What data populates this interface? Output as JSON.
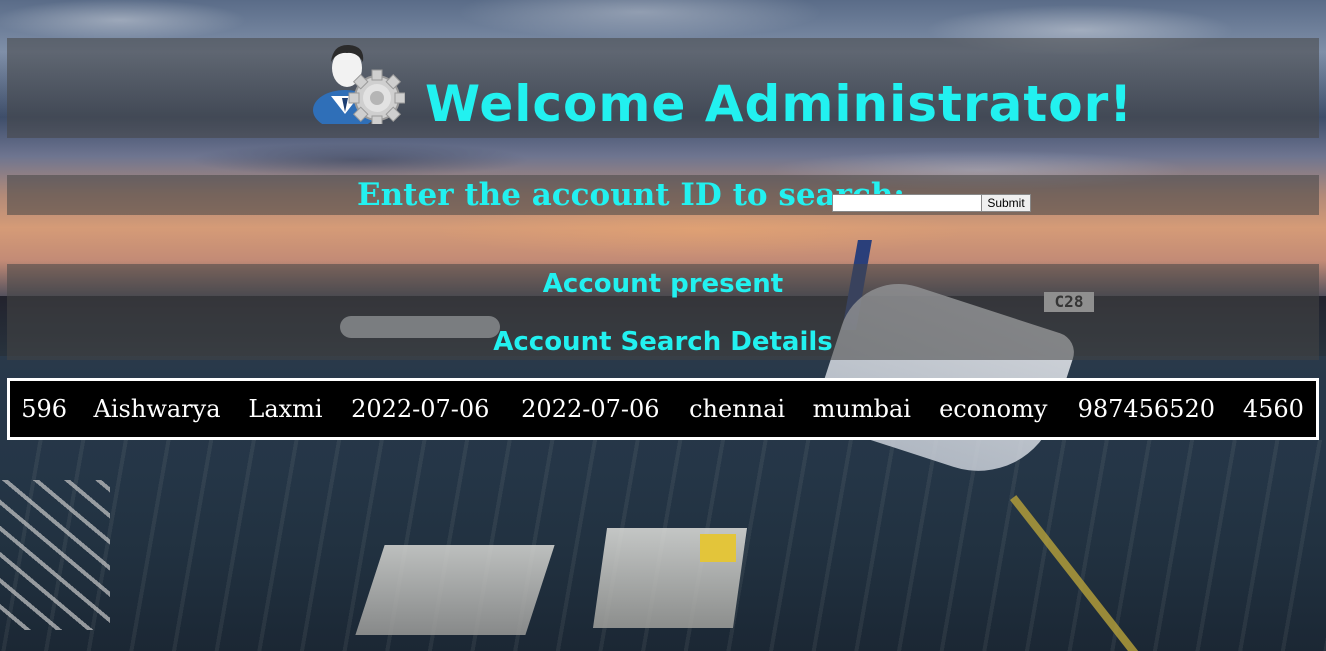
{
  "header": {
    "title": "Welcome Administrator!",
    "icon": "admin-gear-icon"
  },
  "search": {
    "label": "Enter the account ID to search:",
    "input_value": "",
    "submit_label": "Submit"
  },
  "result": {
    "status": "Account present",
    "details_title": "Account Search Details",
    "row": [
      "596",
      "Aishwarya",
      "Laxmi",
      "2022-07-06",
      "2022-07-06",
      "chennai",
      "mumbai",
      "economy",
      "987456520",
      "4560"
    ]
  },
  "colors": {
    "accent_text": "#22f1f0",
    "band": "#464646",
    "table_bg": "#000000",
    "table_border": "#ffffff"
  }
}
